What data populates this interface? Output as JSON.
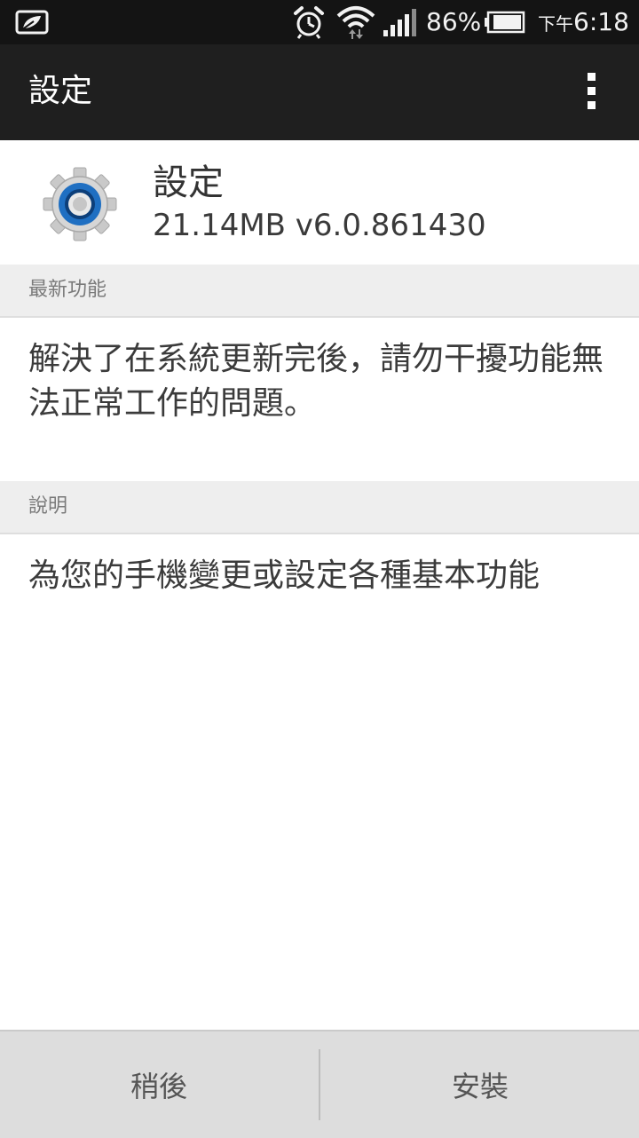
{
  "status_bar": {
    "battery_percent": "86%",
    "time_period": "下午",
    "time": "6:18"
  },
  "app_bar": {
    "title": "設定"
  },
  "app": {
    "name": "設定",
    "meta": "21.14MB v6.0.861430",
    "icon": "gear-icon"
  },
  "whats_new": {
    "header": "最新功能",
    "text": "解決了在系統更新完後，請勿干擾功能無法正常工作的問題。"
  },
  "description": {
    "header": "說明",
    "text": "為您的手機變更或設定各種基本功能"
  },
  "actions": {
    "later": "稍後",
    "install": "安裝"
  },
  "colors": {
    "status_bar_bg": "#141414",
    "app_bar_bg": "#1f1f1f",
    "accent_blue": "#1f6fc2",
    "section_bg": "#eeeeee",
    "bottom_bar_bg": "#dddddd"
  }
}
